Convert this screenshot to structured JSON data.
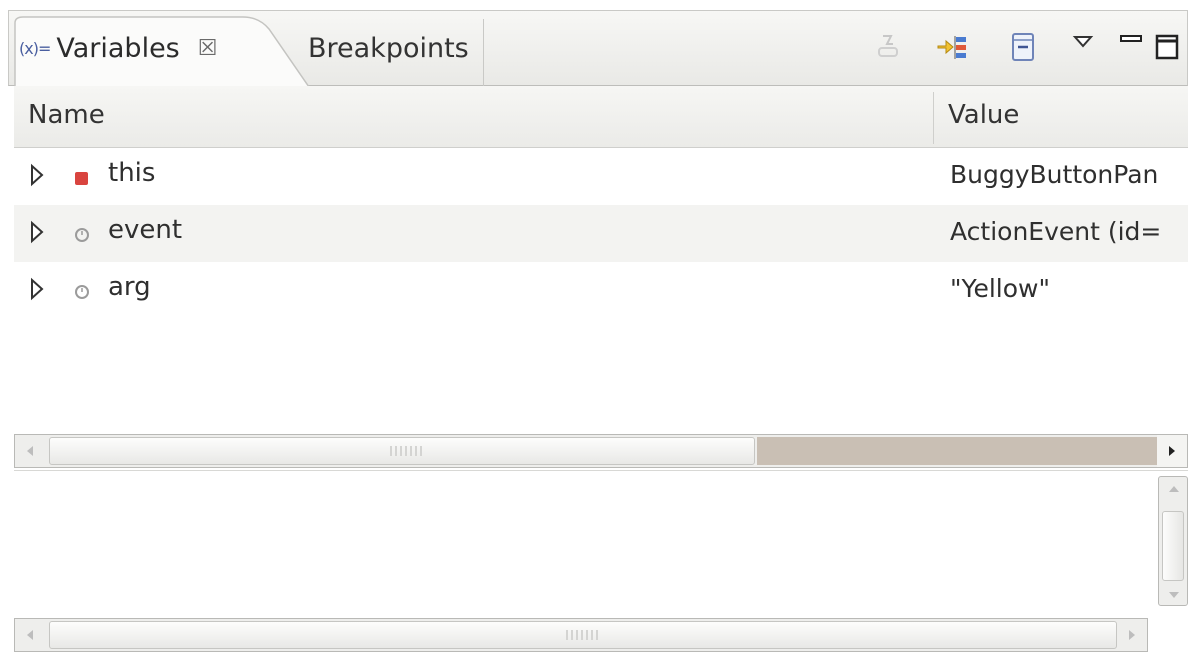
{
  "tabs": {
    "variables_label": "Variables",
    "variables_glyph": "(x)=",
    "close_glyph": "☒",
    "breakpoints_label": "Breakpoints"
  },
  "toolbar": {
    "icons": [
      "show-type-names-icon",
      "show-logical-structure-icon",
      "collapse-all-icon",
      "view-menu-icon",
      "minimize-icon",
      "maximize-icon"
    ]
  },
  "table": {
    "columns": [
      "Name",
      "Value"
    ],
    "rows": [
      {
        "name": "this",
        "value": "BuggyButtonPan",
        "icon": "field-private-icon",
        "icon_color": "#d9443f"
      },
      {
        "name": "event",
        "value": "ActionEvent  (id=",
        "icon": "local-variable-icon",
        "icon_color": "#9b9b9b"
      },
      {
        "name": "arg",
        "value": "\"Yellow\"",
        "icon": "local-variable-icon",
        "icon_color": "#9b9b9b"
      }
    ]
  },
  "colors": {
    "accent_red": "#d9443f",
    "scroll_track": "#c9bfb4"
  }
}
